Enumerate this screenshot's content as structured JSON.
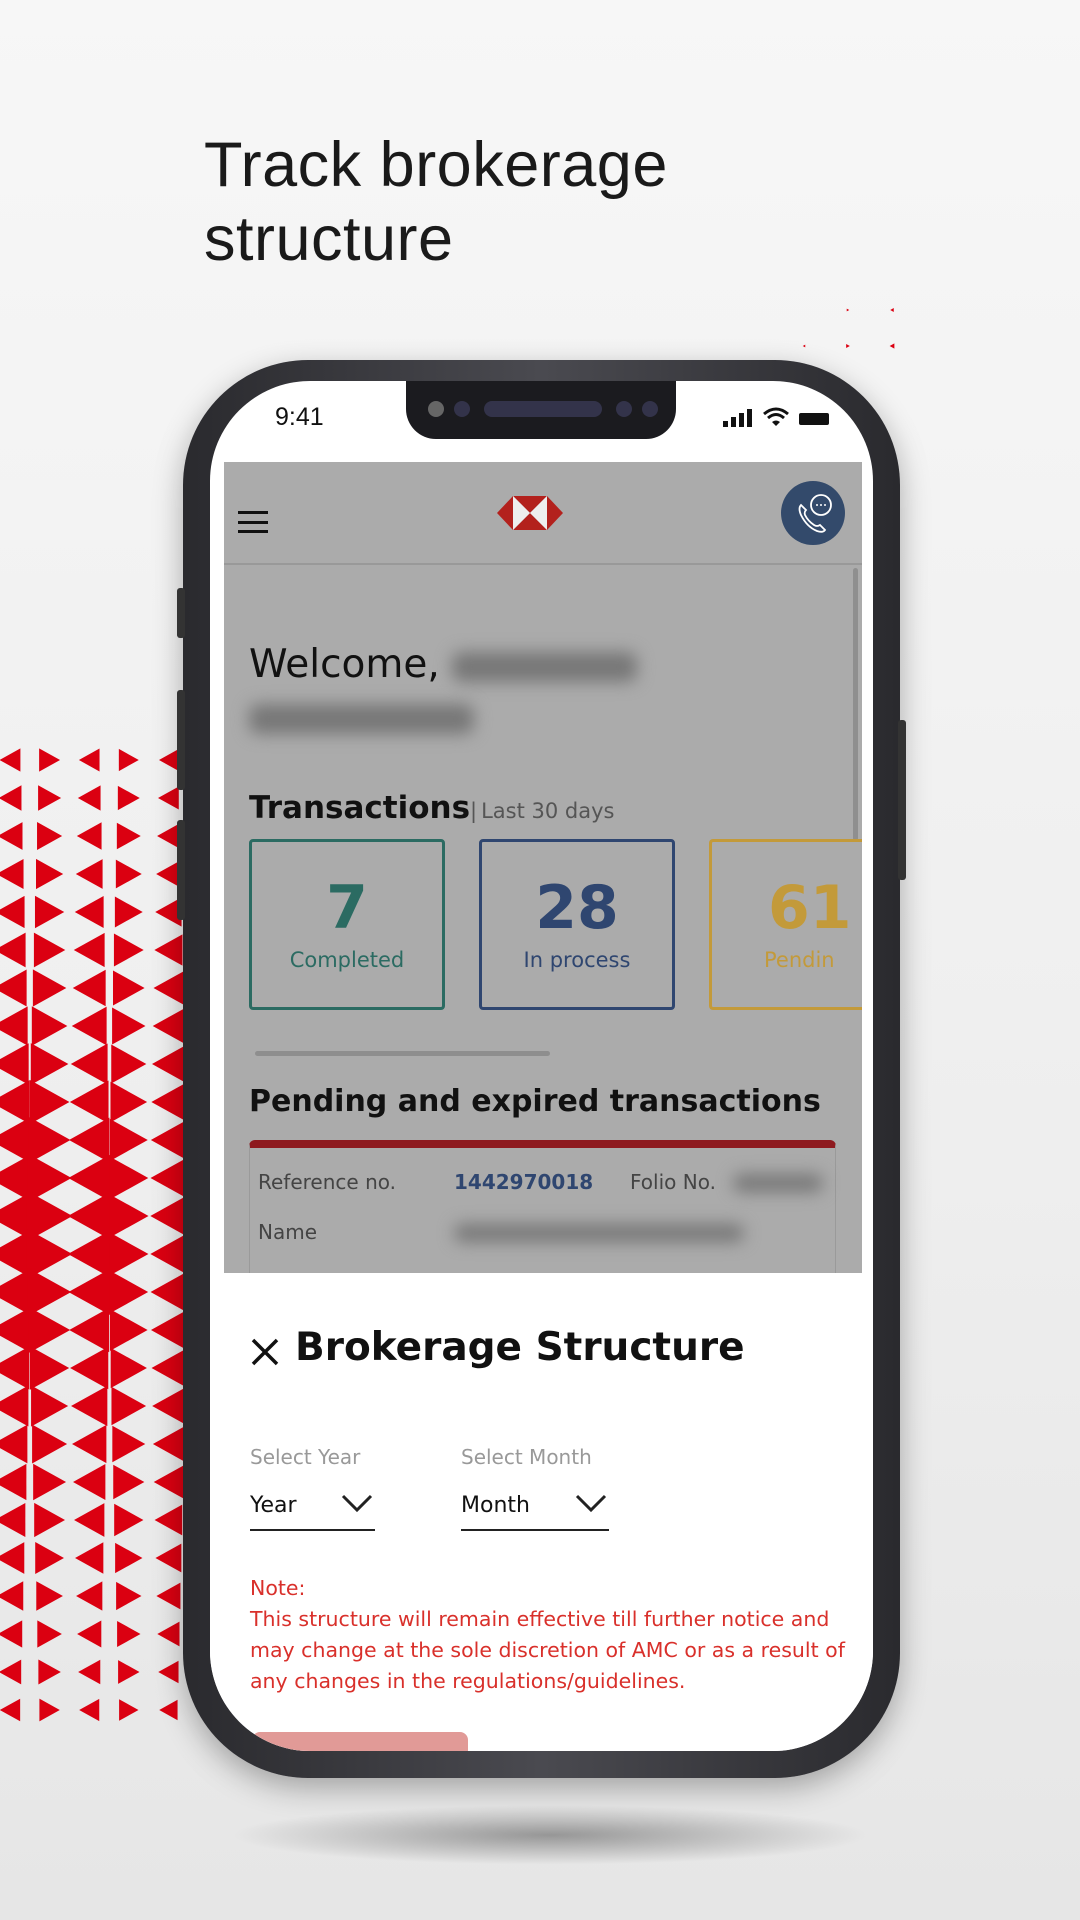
{
  "headline": {
    "line1": "Track brokerage",
    "line2": "structure"
  },
  "status_bar": {
    "time": "9:41"
  },
  "colors": {
    "brand_red": "#db0011",
    "completed": "#2b6b62",
    "in_process": "#2f4670",
    "pending": "#c39a3a",
    "note_red": "#d9302b"
  },
  "header": {
    "menu_icon": "hamburger-icon",
    "logo": "hsbc-hexagon-logo",
    "contact_icon": "phone-chat-icon"
  },
  "welcome": {
    "greeting": "Welcome,"
  },
  "transactions": {
    "title": "Transactions",
    "separator": "|",
    "period": "Last 30 days",
    "cards": [
      {
        "count": "7",
        "label": "Completed"
      },
      {
        "count": "28",
        "label": "In process"
      },
      {
        "count": "61",
        "label": "Pendin"
      }
    ]
  },
  "pending": {
    "title": "Pending and expired transactions",
    "reference_label": "Reference no.",
    "reference_value": "1442970018",
    "folio_label": "Folio No.",
    "name_label": "Name"
  },
  "sheet": {
    "title": "Brokerage Structure",
    "close_icon": "close-icon",
    "year": {
      "label": "Select Year",
      "value": "Year"
    },
    "month": {
      "label": "Select Month",
      "value": "Month"
    },
    "note_title": "Note:",
    "note_text": "This structure will remain effective till further notice and may change at the sole discretion of AMC or as a result of any changes in the regulations/guidelines."
  }
}
